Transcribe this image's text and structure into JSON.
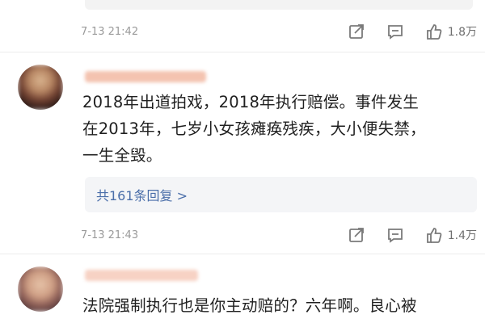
{
  "comments": [
    {
      "time": "7-13 21:42",
      "likes": "1.8万"
    },
    {
      "text": "2018年出道拍戏，2018年执行赔偿。事件发生在2013年，七岁小女孩瘫痪残疾，大小便失禁，一生全毁。",
      "line1": "2018年出道拍戏，2018年执行赔偿。事件发生",
      "line2": "在2013年，七岁小女孩瘫痪残疾，大小便失禁，",
      "line3": "一生全毁。",
      "reply_link": "共161条回复 >",
      "time": "7-13 21:43",
      "likes": "1.4万"
    },
    {
      "line1": "法院强制执行也是你主动赔的？六年啊。良心被"
    }
  ],
  "icons": {
    "share": "share-icon",
    "comment": "comment-icon",
    "like": "thumbs-up-icon"
  },
  "colors": {
    "link": "#4a6ea9",
    "meta": "#9a9a9a",
    "reply_bg": "#f4f5f7"
  }
}
